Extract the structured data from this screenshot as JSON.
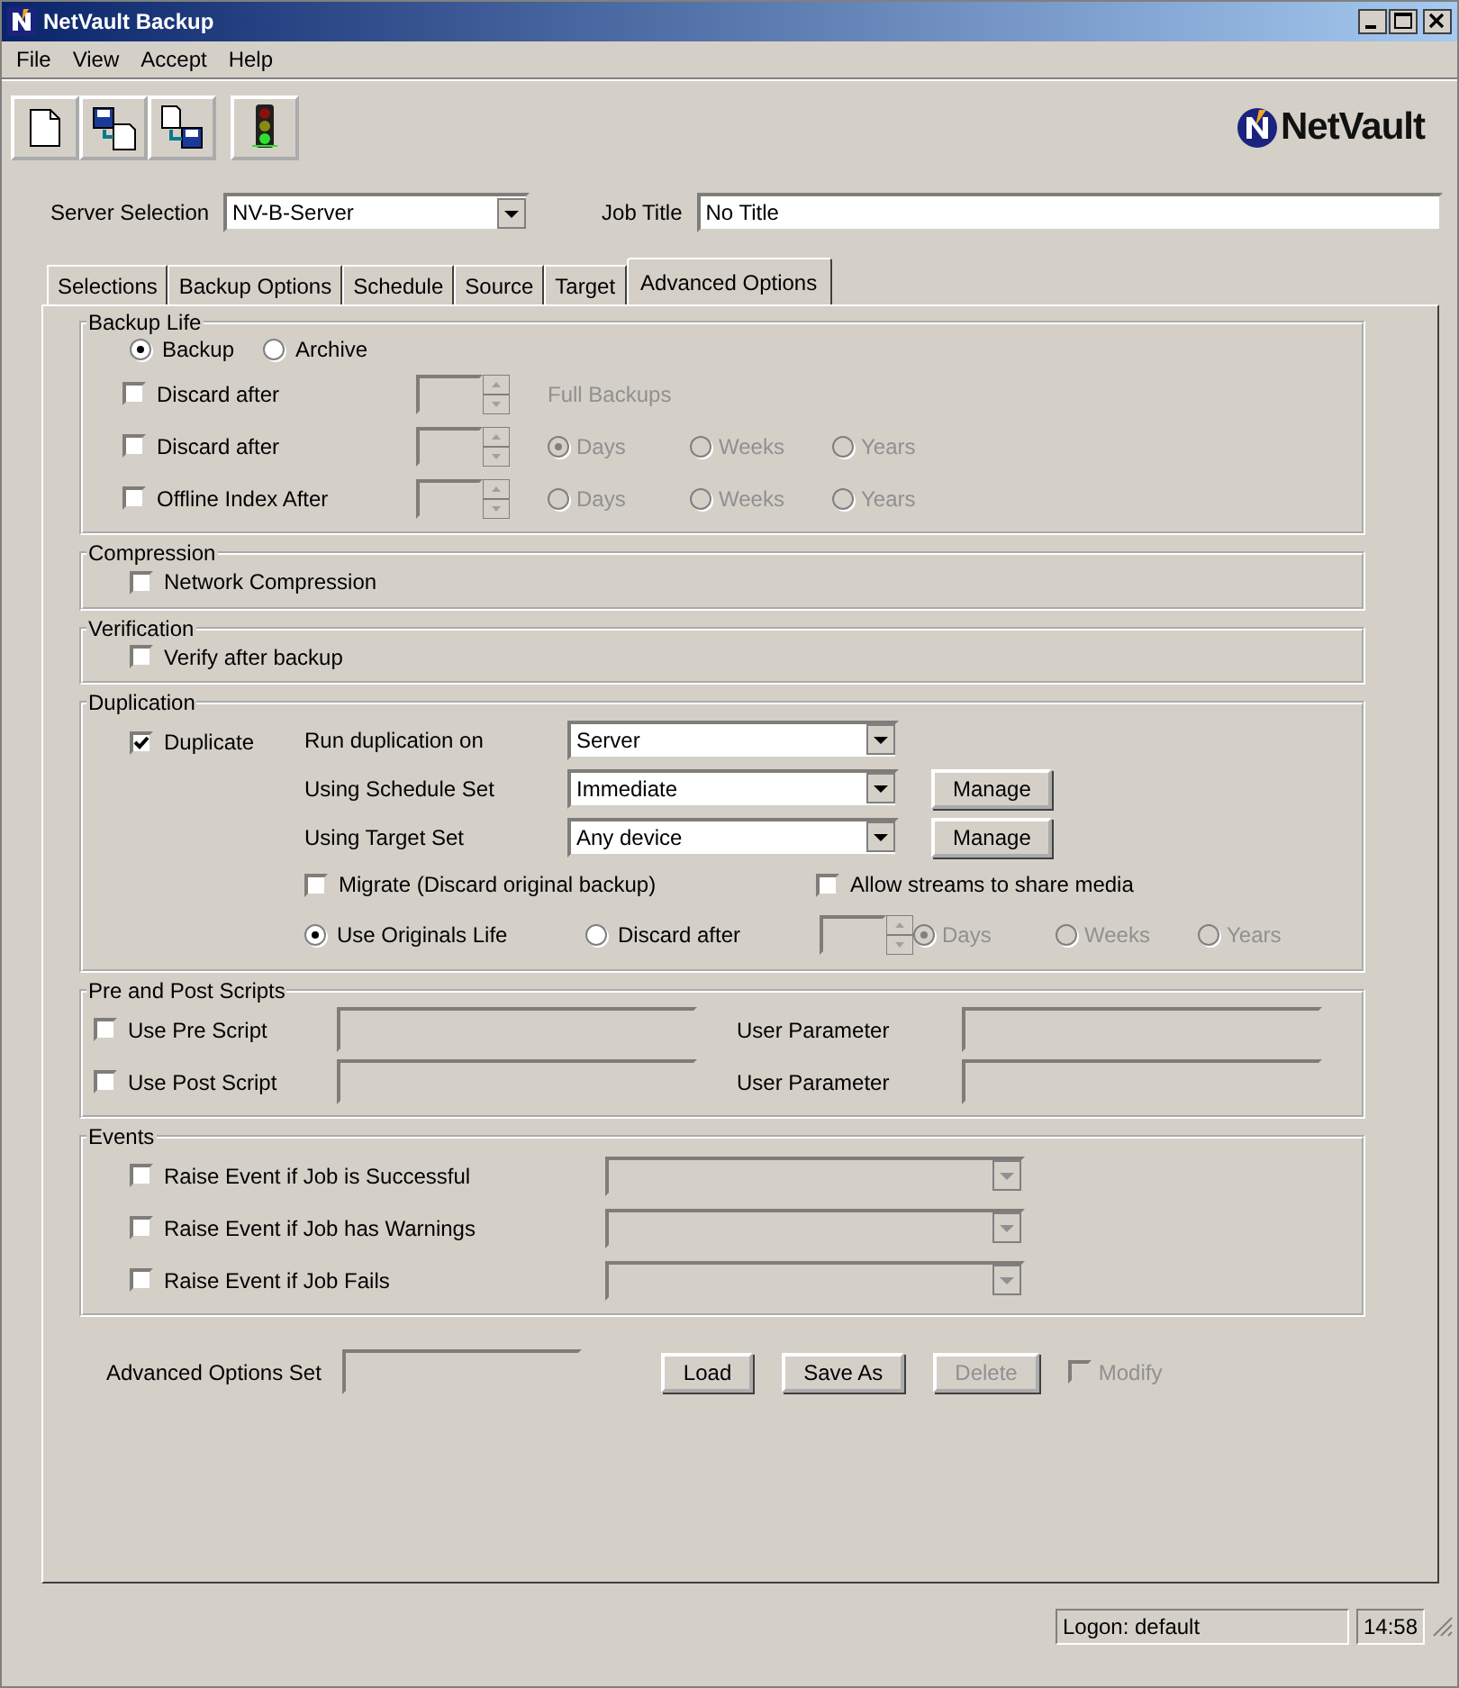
{
  "window": {
    "title": "NetVault Backup"
  },
  "menu": [
    "File",
    "View",
    "Accept",
    "Help"
  ],
  "logo": {
    "text": "NetVault"
  },
  "server": {
    "label": "Server Selection",
    "value": "NV-B-Server"
  },
  "job_title": {
    "label": "Job Title",
    "value": "No Title"
  },
  "tabs": [
    {
      "label": "Selections",
      "selected": false
    },
    {
      "label": "Backup Options",
      "selected": false
    },
    {
      "label": "Schedule",
      "selected": false
    },
    {
      "label": "Source",
      "selected": false
    },
    {
      "label": "Target",
      "selected": false
    },
    {
      "label": "Advanced Options",
      "selected": true
    }
  ],
  "backup_life": {
    "title": "Backup Life",
    "modes": [
      {
        "label": "Backup",
        "selected": true
      },
      {
        "label": "Archive",
        "selected": false
      }
    ],
    "rows": [
      {
        "kind": "text",
        "label": "Discard after",
        "checked": false,
        "disabled": true,
        "suffix": "Full Backups"
      },
      {
        "kind": "units",
        "label": "Discard after",
        "checked": false,
        "disabled": true,
        "units": [
          {
            "label": "Days",
            "selected": true
          },
          {
            "label": "Weeks",
            "selected": false
          },
          {
            "label": "Years",
            "selected": false
          }
        ]
      },
      {
        "kind": "units",
        "label": "Offline Index After",
        "checked": false,
        "disabled": true,
        "units": [
          {
            "label": "Days",
            "selected": false
          },
          {
            "label": "Weeks",
            "selected": false
          },
          {
            "label": "Years",
            "selected": false
          }
        ]
      }
    ]
  },
  "compression": {
    "title": "Compression",
    "option": {
      "label": "Network Compression",
      "checked": false
    }
  },
  "verification": {
    "title": "Verification",
    "option": {
      "label": "Verify after backup",
      "checked": false
    }
  },
  "duplication": {
    "title": "Duplication",
    "duplicate": {
      "label": "Duplicate",
      "checked": true
    },
    "fields": [
      {
        "label": "Run duplication on",
        "value": "Server"
      },
      {
        "label": "Using Schedule Set",
        "value": "Immediate",
        "button": "Manage"
      },
      {
        "label": "Using Target Set",
        "value": "Any device",
        "button": "Manage"
      }
    ],
    "options": [
      {
        "label": "Migrate (Discard original backup)",
        "checked": false
      },
      {
        "label": "Allow streams to share media",
        "checked": false
      }
    ],
    "life": [
      {
        "label": "Use Originals Life",
        "selected": true
      },
      {
        "label": "Discard after",
        "selected": false
      }
    ],
    "disabled": true,
    "units": [
      {
        "label": "Days",
        "selected": true
      },
      {
        "label": "Weeks",
        "selected": false
      },
      {
        "label": "Years",
        "selected": false
      }
    ]
  },
  "scripts": {
    "title": "Pre and Post Scripts",
    "rows": [
      {
        "label": "Use Pre Script",
        "checked": false,
        "param_label": "User Parameter"
      },
      {
        "label": "Use Post Script",
        "checked": false,
        "param_label": "User Parameter"
      }
    ]
  },
  "events": {
    "title": "Events",
    "rows": [
      {
        "label": "Raise Event if Job is Successful",
        "checked": false,
        "disabled": true
      },
      {
        "label": "Raise Event if Job has Warnings",
        "checked": false,
        "disabled": true
      },
      {
        "label": "Raise Event if Job Fails",
        "checked": false,
        "disabled": true
      }
    ]
  },
  "options_set": {
    "label": "Advanced Options Set",
    "buttons": [
      {
        "label": "Load",
        "disabled": false
      },
      {
        "label": "Save As",
        "disabled": false
      },
      {
        "label": "Delete",
        "disabled": true
      }
    ],
    "modify": {
      "label": "Modify",
      "checked": false,
      "disabled": true
    }
  },
  "status_bar": {
    "logon": "Logon: default",
    "time": "14:58"
  }
}
